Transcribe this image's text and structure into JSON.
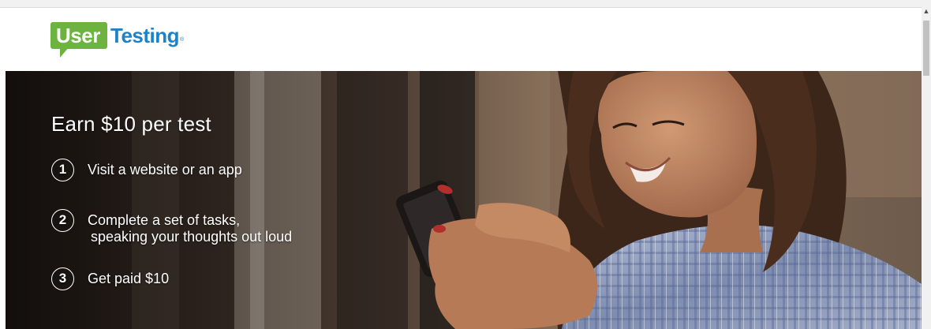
{
  "header": {
    "logo": {
      "part1": "User",
      "part2": "Testing",
      "mark": "®"
    }
  },
  "hero": {
    "headline": "Earn $10 per test",
    "steps": [
      {
        "num": "1",
        "text": "Visit a website or an app"
      },
      {
        "num": "2",
        "text_line1": "Complete a set of tasks,",
        "text_line2": "speaking your thoughts out loud"
      },
      {
        "num": "3",
        "text": "Get paid $10"
      }
    ],
    "image": "woman-using-smartphone-photo"
  },
  "scrollbar": {
    "up_icon": "chevron-up-icon"
  },
  "colors": {
    "brand_green": "#6cb33f",
    "brand_blue": "#1e83c6",
    "hero_text": "#ffffff"
  }
}
